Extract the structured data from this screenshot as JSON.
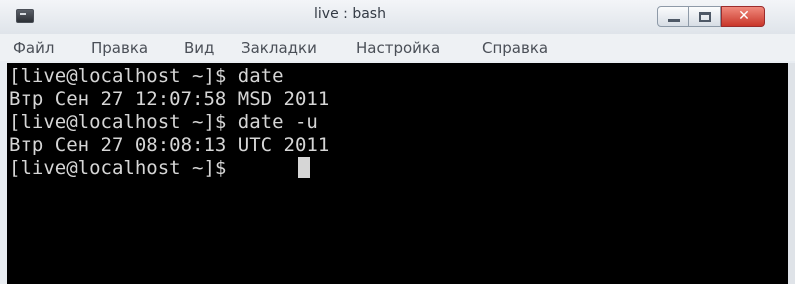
{
  "window": {
    "title": "live : bash",
    "icon": "terminal-icon"
  },
  "title_buttons": {
    "minimize_icon": "minimize-icon",
    "maximize_icon": "maximize-icon",
    "close_label": "✕"
  },
  "menu": {
    "items": [
      {
        "label": "Файл"
      },
      {
        "label": "Правка"
      },
      {
        "label": "Вид"
      },
      {
        "label": "Закладки"
      },
      {
        "label": "Настройка"
      },
      {
        "label": "Справка"
      }
    ]
  },
  "terminal": {
    "lines": [
      "[live@localhost ~]$ date",
      "Втр Сен 27 12:07:58 MSD 2011",
      "[live@localhost ~]$ date -u",
      "Втр Сен 27 08:08:13 UTC 2011",
      "[live@localhost ~]$ "
    ],
    "colors": {
      "background": "#000000",
      "foreground": "#d6d6d6"
    }
  }
}
